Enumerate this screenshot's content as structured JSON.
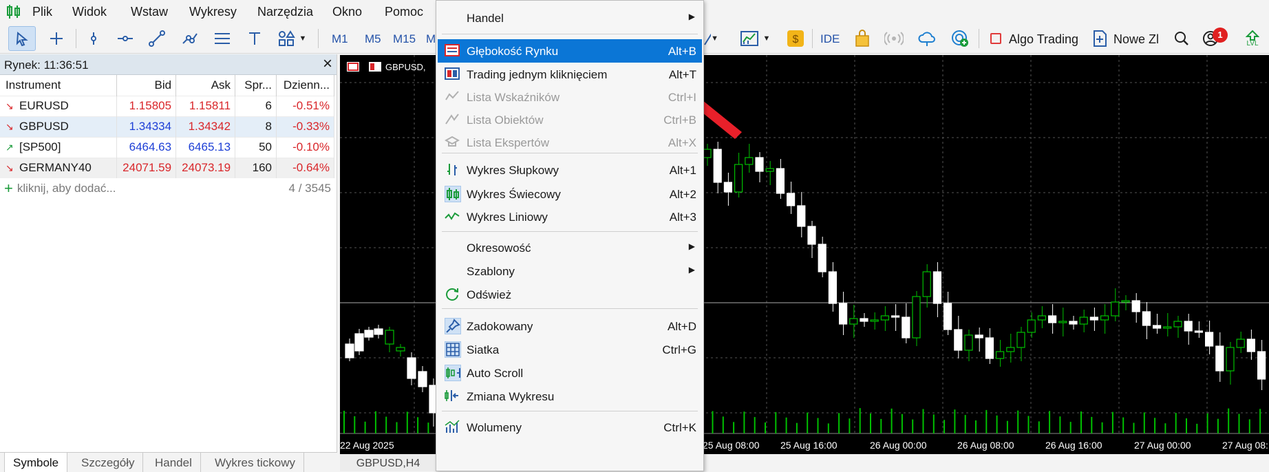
{
  "menu": [
    "Plik",
    "Widok",
    "Wstaw",
    "Wykresy",
    "Narzędzia",
    "Okno",
    "Pomoc"
  ],
  "toolbar": {
    "timeframes": [
      "M1",
      "M5",
      "M15",
      "M"
    ],
    "ide": "IDE",
    "algo_trading": "Algo Trading",
    "new_order": "Nowe Zl",
    "notification_count": "1",
    "lvl": "LVL"
  },
  "market_watch": {
    "title": "Rynek: 11:36:51",
    "columns": [
      "Instrument",
      "Bid",
      "Ask",
      "Spr...",
      "Dzienn..."
    ],
    "rows": [
      {
        "symbol": "EURUSD",
        "bid": "1.15805",
        "ask": "1.15811",
        "spread": "6",
        "daily": "-0.51%"
      },
      {
        "symbol": "GBPUSD",
        "bid": "1.34334",
        "ask": "1.34342",
        "spread": "8",
        "daily": "-0.33%"
      },
      {
        "symbol": "[SP500]",
        "bid": "6464.63",
        "ask": "6465.13",
        "spread": "50",
        "daily": "-0.10%"
      },
      {
        "symbol": "GERMANY40",
        "bid": "24071.59",
        "ask": "24073.19",
        "spread": "160",
        "daily": "-0.64%"
      }
    ],
    "add_hint": "kliknij, aby dodać...",
    "count": "4 / 3545"
  },
  "bottom_tabs": [
    "Symbole",
    "Szczegóły",
    "Handel",
    "Wykres tickowy"
  ],
  "chart": {
    "symbol": "GBPUSD,",
    "tab": "GBPUSD,H4",
    "time_labels": [
      "22 Aug 2025",
      "25 Aug 08:00",
      "25 Aug 16:00",
      "26 Aug 00:00",
      "26 Aug 08:00",
      "26 Aug 16:00",
      "27 Aug 00:00",
      "27 Aug 08:"
    ]
  },
  "dropdown": {
    "items": [
      {
        "label": "Handel",
        "shortcut": "",
        "submenu": true,
        "icon": "",
        "state": "normal"
      },
      {
        "label": "Głębokość Rynku",
        "shortcut": "Alt+B",
        "submenu": false,
        "icon": "depth-of-market-icon",
        "state": "active"
      },
      {
        "label": "Trading jednym kliknięciem",
        "shortcut": "Alt+T",
        "submenu": false,
        "icon": "one-click-trading-icon",
        "state": "normal"
      },
      {
        "label": "Lista Wskaźników",
        "shortcut": "Ctrl+I",
        "submenu": false,
        "icon": "indicators-icon",
        "state": "disabled"
      },
      {
        "label": "Lista Obiektów",
        "shortcut": "Ctrl+B",
        "submenu": false,
        "icon": "objects-icon",
        "state": "disabled"
      },
      {
        "label": "Lista Ekspertów",
        "shortcut": "Alt+X",
        "submenu": false,
        "icon": "experts-icon",
        "state": "disabled"
      },
      {
        "label": "Wykres Słupkowy",
        "shortcut": "Alt+1",
        "submenu": false,
        "icon": "bar-chart-icon",
        "state": "normal"
      },
      {
        "label": "Wykres Świecowy",
        "shortcut": "Alt+2",
        "submenu": false,
        "icon": "candle-chart-icon",
        "state": "checked"
      },
      {
        "label": "Wykres Liniowy",
        "shortcut": "Alt+3",
        "submenu": false,
        "icon": "line-chart-icon",
        "state": "normal"
      },
      {
        "label": "Okresowość",
        "shortcut": "",
        "submenu": true,
        "icon": "",
        "state": "normal"
      },
      {
        "label": "Szablony",
        "shortcut": "",
        "submenu": true,
        "icon": "",
        "state": "normal"
      },
      {
        "label": "Odśwież",
        "shortcut": "",
        "submenu": false,
        "icon": "refresh-icon",
        "state": "normal"
      },
      {
        "label": "Zadokowany",
        "shortcut": "Alt+D",
        "submenu": false,
        "icon": "pin-icon",
        "state": "checked"
      },
      {
        "label": "Siatka",
        "shortcut": "Ctrl+G",
        "submenu": false,
        "icon": "grid-icon",
        "state": "checked"
      },
      {
        "label": "Auto Scroll",
        "shortcut": "",
        "submenu": false,
        "icon": "auto-scroll-icon",
        "state": "checked"
      },
      {
        "label": "Zmiana Wykresu",
        "shortcut": "",
        "submenu": false,
        "icon": "chart-shift-icon",
        "state": "normal"
      },
      {
        "label": "Wolumeny",
        "shortcut": "Ctrl+K",
        "submenu": false,
        "icon": "volumes-icon",
        "state": "normal"
      }
    ]
  },
  "colors": {
    "accent": "#0b76d6",
    "bull": "#00c000",
    "bear": "#ffffff",
    "arrow": "#e8202a"
  }
}
